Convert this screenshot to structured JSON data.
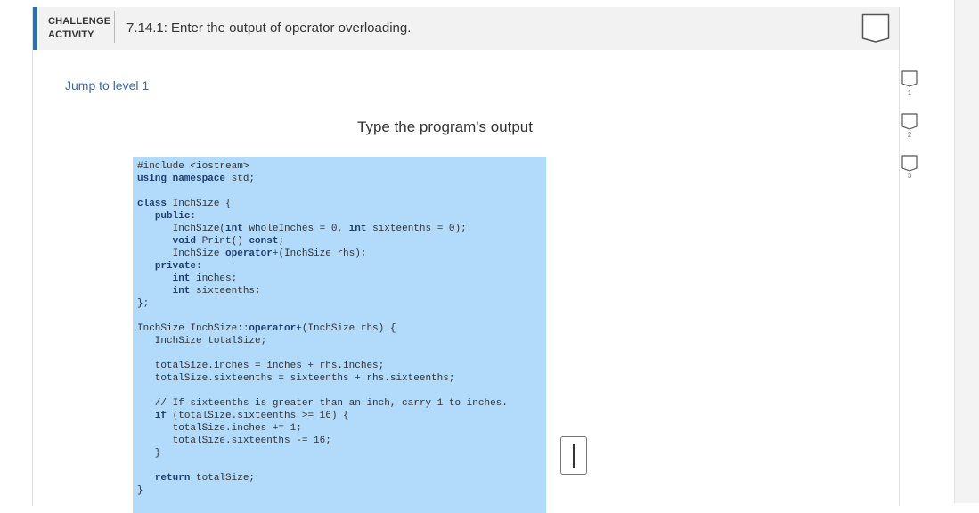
{
  "header": {
    "label_line1": "CHALLENGE",
    "label_line2": "ACTIVITY",
    "title": "7.14.1: Enter the output of operator overloading.",
    "accent_color": "#1a73c8"
  },
  "jump_link": "Jump to level 1",
  "prompt": "Type the program's output",
  "code": {
    "background": "#b2dafa",
    "lines": [
      "#include <iostream>",
      "using namespace std;",
      "",
      "class InchSize {",
      "   public:",
      "      InchSize(int wholeInches = 0, int sixteenths = 0);",
      "      void Print() const;",
      "      InchSize operator+(InchSize rhs);",
      "   private:",
      "      int inches;",
      "      int sixteenths;",
      "};",
      "",
      "InchSize InchSize::operator+(InchSize rhs) {",
      "   InchSize totalSize;",
      "",
      "   totalSize.inches = inches + rhs.inches;",
      "   totalSize.sixteenths = sixteenths + rhs.sixteenths;",
      "",
      "   // If sixteenths is greater than an inch, carry 1 to inches.",
      "   if (totalSize.sixteenths >= 16) {",
      "      totalSize.inches += 1;",
      "      totalSize.sixteenths -= 16;",
      "   }",
      "",
      "   return totalSize;",
      "}"
    ]
  },
  "answer": {
    "value": ""
  },
  "levels": {
    "items": [
      {
        "number": "1",
        "icon": "level-square-icon"
      },
      {
        "number": "2",
        "icon": "level-square-icon"
      },
      {
        "number": "3",
        "icon": "level-square-icon"
      }
    ]
  }
}
